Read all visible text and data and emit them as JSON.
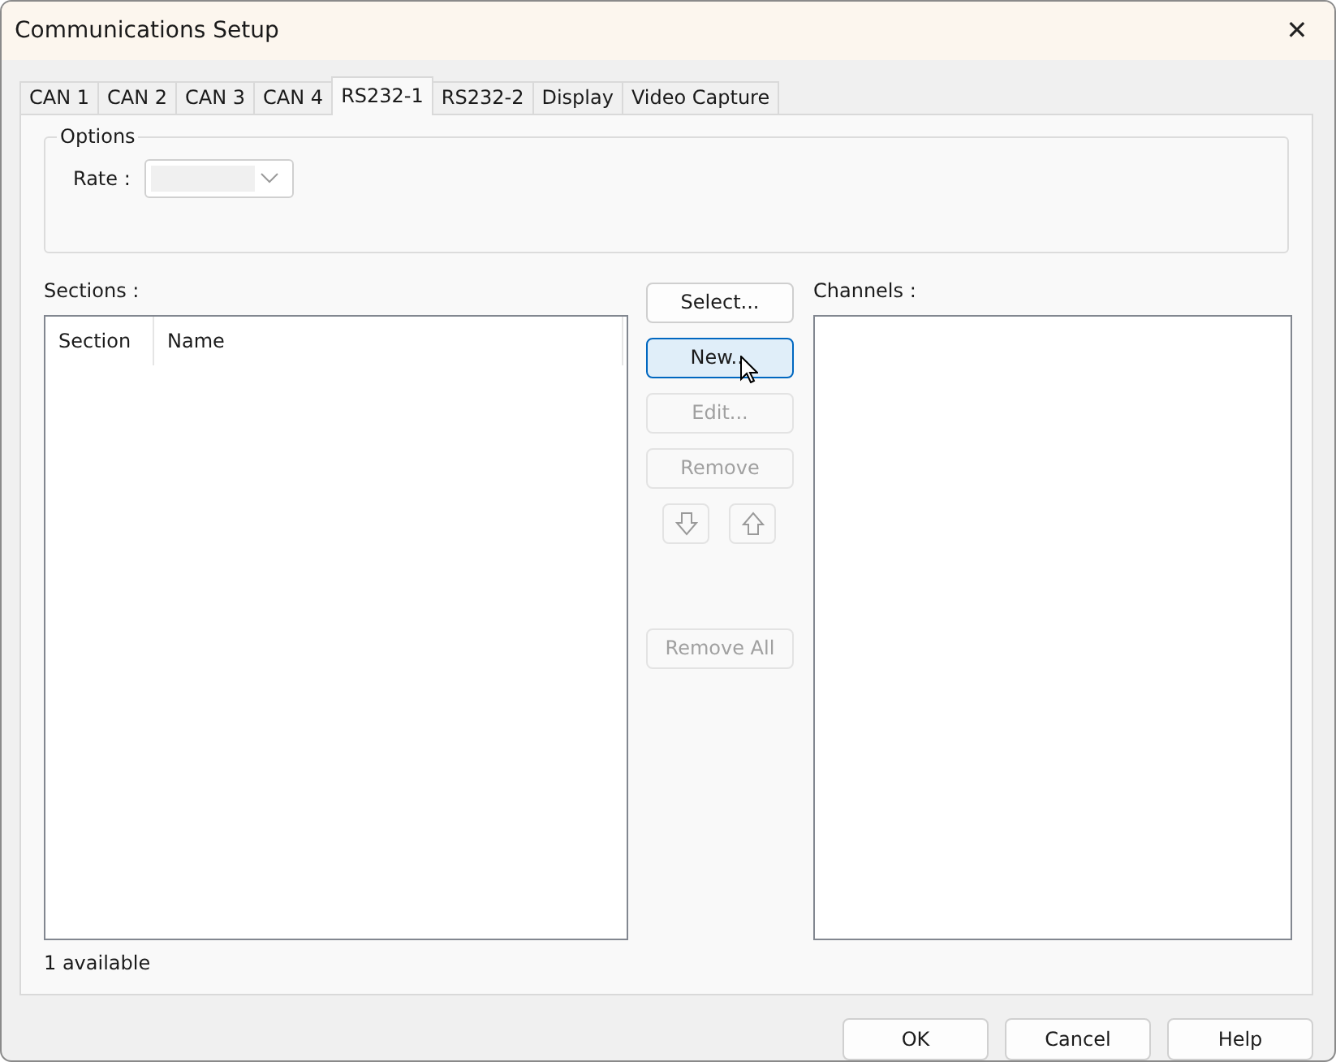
{
  "window": {
    "title": "Communications Setup",
    "close": "✕"
  },
  "tabs": [
    {
      "label": "CAN 1",
      "selected": false
    },
    {
      "label": "CAN 2",
      "selected": false
    },
    {
      "label": "CAN 3",
      "selected": false
    },
    {
      "label": "CAN 4",
      "selected": false
    },
    {
      "label": "RS232-1",
      "selected": true
    },
    {
      "label": "RS232-2",
      "selected": false
    },
    {
      "label": "Display",
      "selected": false
    },
    {
      "label": "Video Capture",
      "selected": false
    }
  ],
  "options": {
    "title": "Options",
    "rate": {
      "label": "Rate :",
      "disabled": true
    }
  },
  "sections": {
    "label": "Sections :",
    "columns": [
      "Section",
      "Name"
    ],
    "status": "1 available"
  },
  "actions": [
    {
      "label": "Select...",
      "disabled": false,
      "hovered": false
    },
    {
      "label": "New...",
      "disabled": false,
      "hovered": true
    },
    {
      "label": "Edit...",
      "disabled": true,
      "hovered": false
    },
    {
      "label": "Remove",
      "disabled": true,
      "hovered": false
    }
  ],
  "move_buttons": [
    {
      "kind": "down",
      "disabled": true
    },
    {
      "kind": "up",
      "disabled": true
    }
  ],
  "remove_all": {
    "label": "Remove All",
    "disabled": true
  },
  "channels": {
    "label": "Channels :"
  },
  "footer_buttons": [
    "OK",
    "Cancel",
    "Help"
  ]
}
